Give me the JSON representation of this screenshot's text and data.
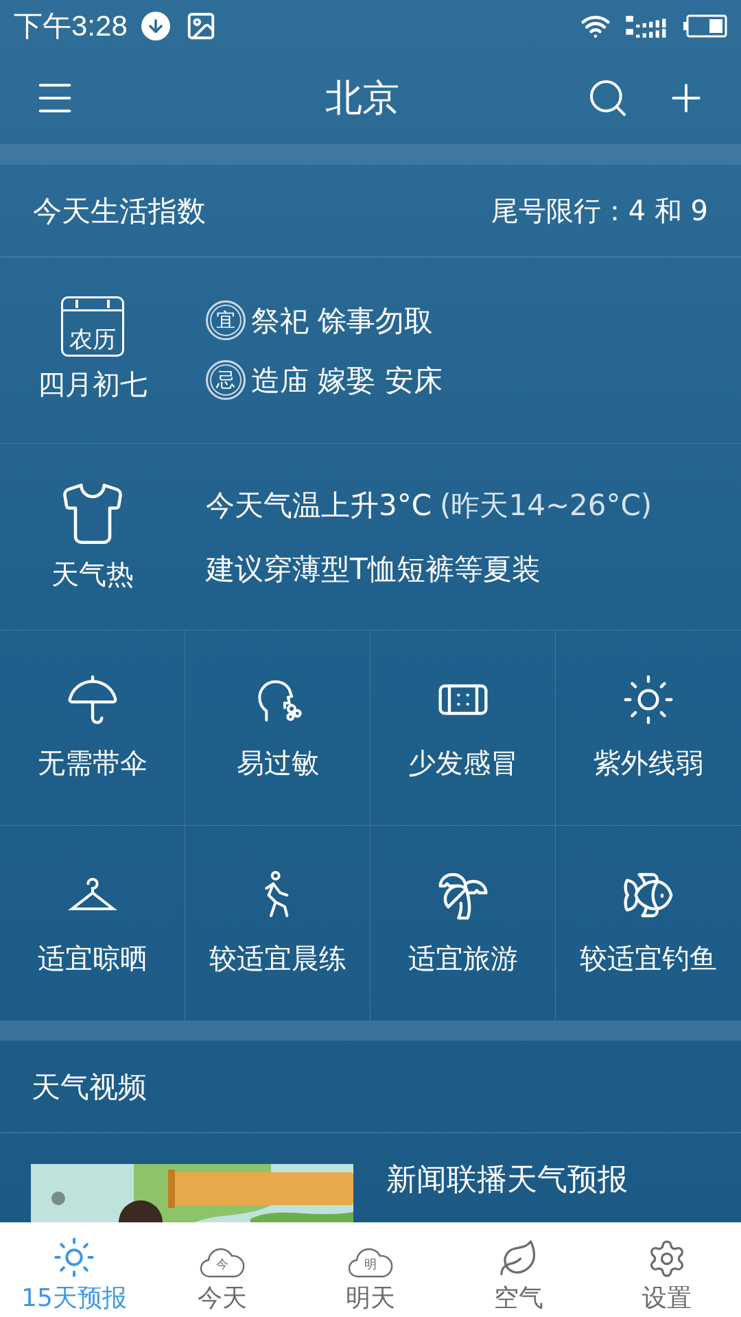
{
  "status_bar": {
    "time": "下午3:28"
  },
  "header": {
    "title": "北京"
  },
  "life_index": {
    "title": "今天生活指数",
    "restriction": "尾号限行：4 和 9"
  },
  "almanac": {
    "lunar_icon_text": "农历",
    "lunar_date": "四月初七",
    "rows": [
      {
        "badge": "宜",
        "text": "祭祀 馀事勿取"
      },
      {
        "badge": "忌",
        "text": "造庙 嫁娶 安床"
      }
    ]
  },
  "clothing": {
    "label": "天气热",
    "line_1": "今天气温上升3°C",
    "line_1_note": "(昨天14~26°C)",
    "line_2": "建议穿薄型T恤短裤等夏装"
  },
  "indices": [
    {
      "kind": "umbrella",
      "label": "无需带伞"
    },
    {
      "kind": "allergy",
      "label": "易过敏"
    },
    {
      "kind": "bandage",
      "label": "少发感冒"
    },
    {
      "kind": "sun",
      "label": "紫外线弱"
    },
    {
      "kind": "hanger",
      "label": "适宜晾晒"
    },
    {
      "kind": "runner",
      "label": "较适宜晨练"
    },
    {
      "kind": "palm",
      "label": "适宜旅游"
    },
    {
      "kind": "fish",
      "label": "较适宜钓鱼"
    }
  ],
  "video": {
    "title": "天气视频",
    "items": [
      {
        "kind": "picture",
        "title": "新闻联播天气预报"
      }
    ]
  },
  "bottom_nav": [
    {
      "kind": "sun",
      "label": "15天预报",
      "selected": true
    },
    {
      "kind": "cloud",
      "icon_text": "今",
      "label": "今天",
      "selected": false
    },
    {
      "kind": "cloud",
      "icon_text": "明",
      "label": "明天",
      "selected": false
    },
    {
      "kind": "leaf",
      "label": "空气",
      "selected": false
    },
    {
      "kind": "gear",
      "label": "设置",
      "selected": false
    }
  ]
}
